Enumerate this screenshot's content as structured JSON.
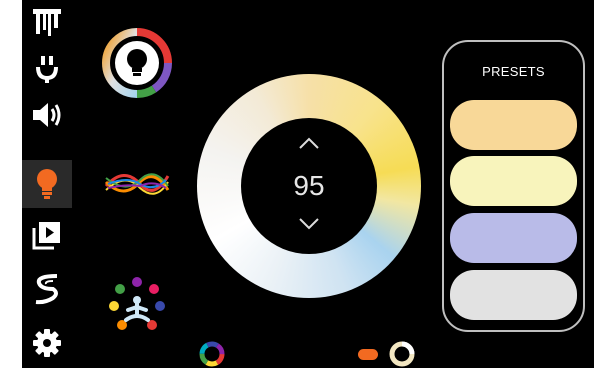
{
  "nav": {
    "items": [
      {
        "name": "logo",
        "icon": "brand-logo-icon",
        "active": false
      },
      {
        "name": "power",
        "icon": "power-icon",
        "active": false
      },
      {
        "name": "volume",
        "icon": "speaker-icon",
        "active": false
      },
      {
        "name": "lighting",
        "icon": "lightbulb-icon",
        "active": true
      },
      {
        "name": "media",
        "icon": "media-library-icon",
        "active": false
      },
      {
        "name": "scenes",
        "icon": "swirl-icon",
        "active": false
      },
      {
        "name": "settings",
        "icon": "gear-icon",
        "active": false
      }
    ]
  },
  "colors": {
    "accent": "#f26a21",
    "background": "#000000",
    "text": "#e6e6e6"
  },
  "wheel": {
    "value": "95"
  },
  "presets": {
    "title": "PRESETS",
    "items": [
      {
        "color": "#f8d898"
      },
      {
        "color": "#f8f4bc"
      },
      {
        "color": "#b9bbe8"
      },
      {
        "color": "#e2e2e2"
      }
    ]
  }
}
